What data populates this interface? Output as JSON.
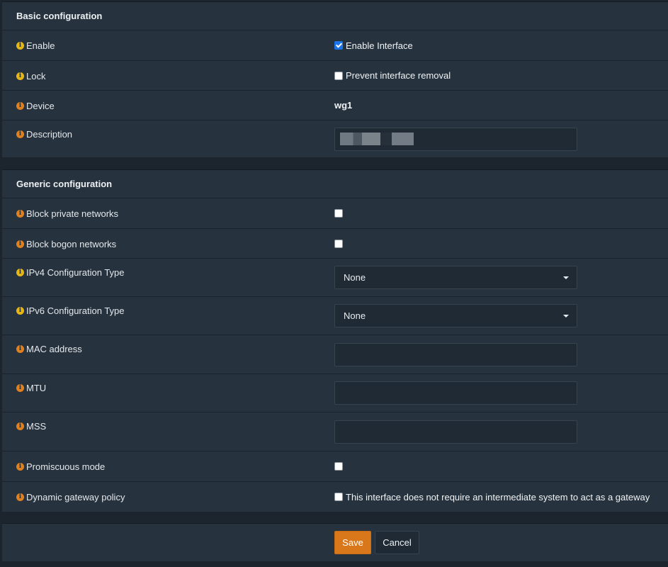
{
  "basic": {
    "title": "Basic configuration",
    "enable": {
      "label": "Enable",
      "checkbox_label": "Enable Interface",
      "checked": true
    },
    "lock": {
      "label": "Lock",
      "checkbox_label": "Prevent interface removal",
      "checked": false
    },
    "device": {
      "label": "Device",
      "value": "wg1"
    },
    "description": {
      "label": "Description",
      "value": ""
    }
  },
  "generic": {
    "title": "Generic configuration",
    "block_private": {
      "label": "Block private networks",
      "checked": false
    },
    "block_bogon": {
      "label": "Block bogon networks",
      "checked": false
    },
    "ipv4": {
      "label": "IPv4 Configuration Type",
      "selected": "None"
    },
    "ipv6": {
      "label": "IPv6 Configuration Type",
      "selected": "None"
    },
    "mac": {
      "label": "MAC address",
      "value": ""
    },
    "mtu": {
      "label": "MTU",
      "value": ""
    },
    "mss": {
      "label": "MSS",
      "value": ""
    },
    "promiscuous": {
      "label": "Promiscuous mode",
      "checked": false
    },
    "dynamic_gateway": {
      "label": "Dynamic gateway policy",
      "checkbox_label": "This interface does not require an intermediate system to act as a gateway",
      "checked": false
    }
  },
  "actions": {
    "save_label": "Save",
    "cancel_label": "Cancel"
  },
  "colors": {
    "save": "#d9781b",
    "info_yellow": "#e6b619",
    "info_orange": "#e0801f",
    "panel": "#26323d",
    "background": "#1c252e"
  },
  "icons": {
    "info": "info-circle-icon",
    "caret": "caret-down-icon"
  }
}
